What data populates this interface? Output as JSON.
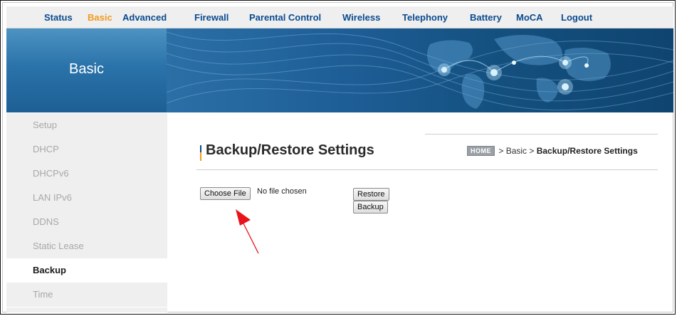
{
  "nav": {
    "items": [
      "Status",
      "Basic",
      "Advanced",
      "Firewall",
      "Parental Control",
      "Wireless",
      "Telephony",
      "Battery",
      "MoCA",
      "Logout"
    ],
    "active": "Basic"
  },
  "banner": {
    "title": "Basic"
  },
  "sidebar": {
    "items": [
      "Setup",
      "DHCP",
      "DHCPv6",
      "LAN IPv6",
      "DDNS",
      "Static Lease",
      "Backup",
      "Time"
    ],
    "active": "Backup"
  },
  "content": {
    "title": "Backup/Restore Settings",
    "breadcrumb": {
      "home": "HOME",
      "path": [
        "Basic",
        "Backup/Restore Settings"
      ]
    },
    "choose_file_label": "Choose File",
    "no_file_text": "No file chosen",
    "restore_label": "Restore",
    "backup_label": "Backup"
  },
  "colors": {
    "nav_link": "#0a4b8f",
    "nav_active": "#f39a1e",
    "annotation_arrow": "#e8141b"
  }
}
